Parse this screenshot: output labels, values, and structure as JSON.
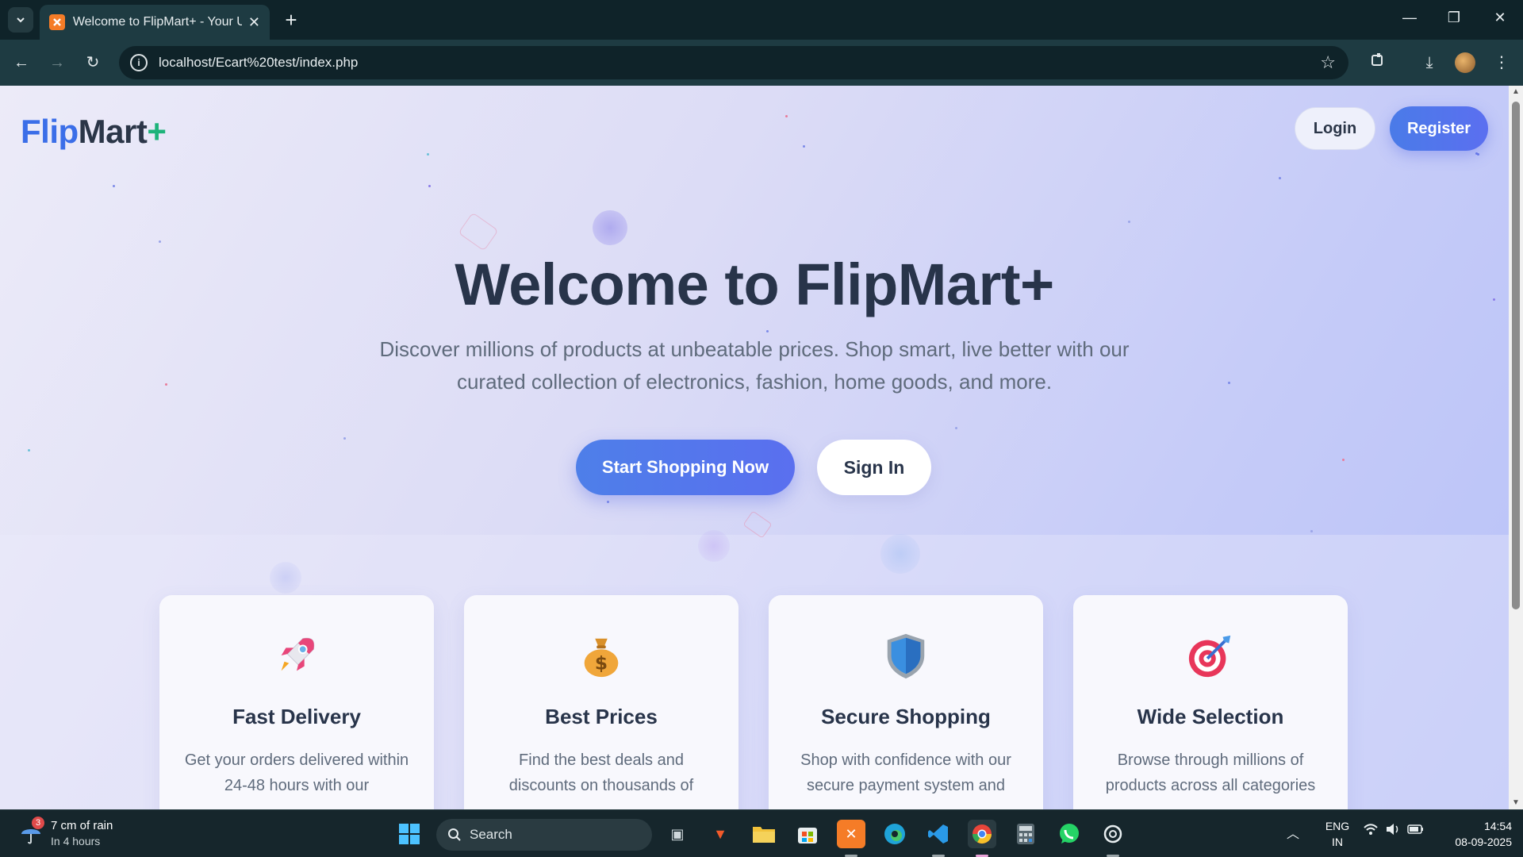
{
  "browser": {
    "tab_title": "Welcome to FlipMart+ - Your U",
    "new_tab": "+",
    "tab_close": "✕",
    "url": "localhost/Ecart%20test/index.php"
  },
  "page": {
    "logo": {
      "flip": "Flip",
      "mart": "Mart",
      "plus": "+"
    },
    "nav": {
      "login": "Login",
      "register": "Register"
    },
    "hero": {
      "title": "Welcome to FlipMart+",
      "subtitle": "Discover millions of products at unbeatable prices. Shop smart, live better with our curated collection of electronics, fashion, home goods, and more.",
      "primary_cta": "Start Shopping Now",
      "secondary_cta": "Sign In"
    },
    "features": [
      {
        "icon": "rocket-icon",
        "title": "Fast Delivery",
        "text": "Get your orders delivered within 24-48 hours with our"
      },
      {
        "icon": "money-bag-icon",
        "title": "Best Prices",
        "text": "Find the best deals and discounts on thousands of"
      },
      {
        "icon": "shield-icon",
        "title": "Secure Shopping",
        "text": "Shop with confidence with our secure payment system and"
      },
      {
        "icon": "target-icon",
        "title": "Wide Selection",
        "text": "Browse through millions of products across all categories"
      }
    ]
  },
  "taskbar": {
    "weather_badge": "3",
    "weather_main": "7 cm of rain",
    "weather_sub": "In 4 hours",
    "search_label": "Search",
    "lang_line1": "ENG",
    "lang_line2": "IN",
    "time": "14:54",
    "date": "08-09-2025"
  },
  "colors": {
    "brand_blue": "#3b6ee8",
    "brand_dark": "#2b3648",
    "brand_green": "#1db37a",
    "cta_gradient_start": "#4e7fe9",
    "cta_gradient_end": "#5a6fef"
  }
}
